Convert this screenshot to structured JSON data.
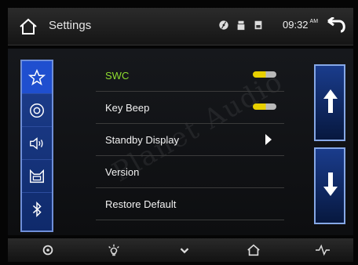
{
  "header": {
    "title": "Settings",
    "time": "09:32",
    "ampm": "AM",
    "icons": [
      "home-icon",
      "disc-icon",
      "usb-icon",
      "sd-card-icon",
      "back-icon"
    ]
  },
  "sidebar": {
    "items": [
      {
        "name": "favorites-icon",
        "active": true
      },
      {
        "name": "disc-icon"
      },
      {
        "name": "volume-icon"
      },
      {
        "name": "car-icon"
      },
      {
        "name": "bluetooth-icon"
      }
    ]
  },
  "settings": {
    "items": [
      {
        "label": "SWC",
        "control": "toggle",
        "value": "on",
        "active": true
      },
      {
        "label": "Key Beep",
        "control": "toggle",
        "value": "on"
      },
      {
        "label": "Standby Display",
        "control": "arrow"
      },
      {
        "label": "Version"
      },
      {
        "label": "Restore Default"
      }
    ]
  },
  "scroll": {
    "up_icon": "arrow-up-icon",
    "down_icon": "arrow-down-icon"
  },
  "bottom_bar": {
    "icons": [
      "settings-gear-icon",
      "brightness-icon",
      "chevron-down-icon",
      "home-icon",
      "equalizer-icon"
    ]
  },
  "watermark": "Planet Audio",
  "colors": {
    "accent_blue": "#1f4fcf",
    "active_label": "#8fdc2f",
    "toggle_on": "#e8d000"
  }
}
